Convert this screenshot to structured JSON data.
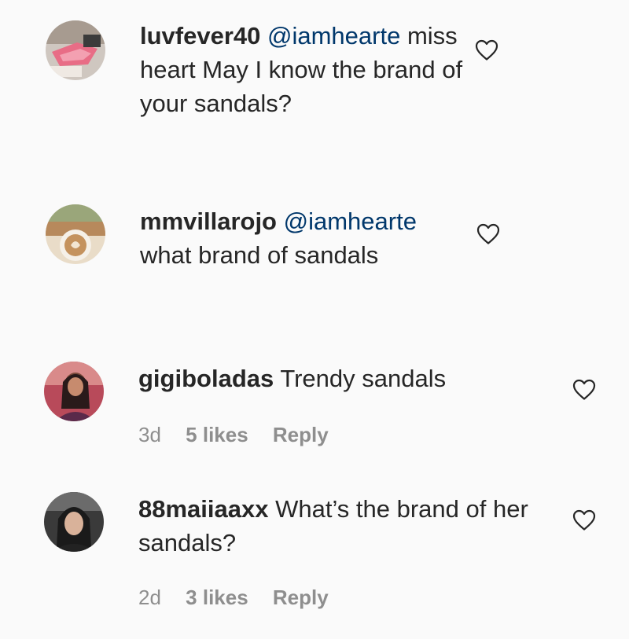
{
  "comments": [
    {
      "username": "luvfever40",
      "mention": "@iamhearte",
      "text": "miss heart May I know the brand of your sandals?",
      "time": "",
      "likes": "",
      "reply": ""
    },
    {
      "username": "mmvillarojo",
      "mention": "@iamhearte",
      "text": "what brand of sandals",
      "time": "",
      "likes": "",
      "reply": ""
    },
    {
      "username": "gigiboladas",
      "mention": "",
      "text": "Trendy sandals",
      "time": "3d",
      "likes": "5 likes",
      "reply": "Reply"
    },
    {
      "username": "88maiiaaxx",
      "mention": "",
      "text": "What’s the brand of her sandals?",
      "time": "2d",
      "likes": "3 likes",
      "reply": "Reply"
    }
  ],
  "icons": {
    "like": "heart-outline-icon"
  }
}
